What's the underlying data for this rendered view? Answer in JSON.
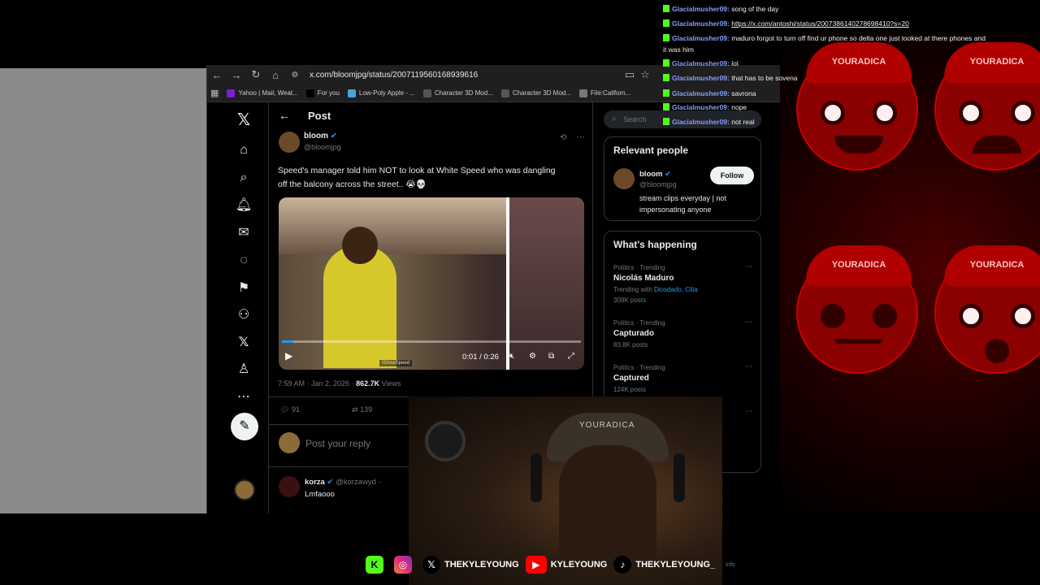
{
  "browser": {
    "url": "x.com/bloomjpg/status/2007119560168939616",
    "bookmarks": [
      {
        "label": "Yahoo | Mail, Weat...",
        "color": "#7b1fd2"
      },
      {
        "label": "For you",
        "color": "#000000"
      },
      {
        "label": "Low-Poly Apple - ...",
        "color": "#4aa3df"
      },
      {
        "label": "Character 3D Mod...",
        "color": "#555555"
      },
      {
        "label": "Character 3D Mod...",
        "color": "#555555"
      },
      {
        "label": "File:Californ...",
        "color": "#777777"
      }
    ]
  },
  "post": {
    "header_title": "Post",
    "author_name": "bloom",
    "author_handle": "@bloomjpg",
    "text_line1": "Speed's manager told him NOT to look at White Speed who was dangling",
    "text_line2": "off the balcony across the street.. 😭💀",
    "video_time": "0:01 / 0:26",
    "video_watermark": "IShowSpeed",
    "timestamp": "7:59 AM · Jan 2, 2026 ·",
    "views_count": "862.7K",
    "views_label": "Views",
    "replies": "91",
    "reposts": "139",
    "reply_placeholder": "Post your reply",
    "reply_author": "korza",
    "reply_handle": "@korzawyd ·",
    "reply_text": "Lmfaooo"
  },
  "sidebar": {
    "search_placeholder": "Search",
    "relevant_title": "Relevant people",
    "relevant_name": "bloom",
    "relevant_handle": "@bloomjpg",
    "follow_label": "Follow",
    "relevant_bio_line1": "stream clips everyday | not",
    "relevant_bio_line2": "impersonating anyone",
    "happening_title": "What's happening",
    "trends": [
      {
        "context": "Politics · Trending",
        "name": "Nicolás Maduro",
        "with_label": "Trending with",
        "with_links": "Diosdado, Cilia",
        "posts": "309K posts"
      },
      {
        "context": "Politics · Trending",
        "name": "Capturado",
        "posts": "83.8K posts"
      },
      {
        "context": "Politics · Trending",
        "name": "Captured",
        "posts": "124K posts"
      }
    ],
    "footer_info": "Info"
  },
  "chat": [
    {
      "user": "Glacialmusher09:",
      "msg": "song of the day"
    },
    {
      "user": "Glacialmusher09:",
      "msg": "https://x.com/antoshi/status/2007386140278698410?s=20"
    },
    {
      "user": "Glacialmusher09:",
      "msg": "maduro forgot to turn off find ur phone so delta one just looked at there phones and"
    },
    {
      "user": "",
      "msg": "it was him"
    },
    {
      "user": "Glacialmusher09:",
      "msg": "lol"
    },
    {
      "user": "Glacialmusher09:",
      "msg": "that has to be sovena"
    },
    {
      "user": "Glacialmusher09:",
      "msg": "savrona"
    },
    {
      "user": "Glacialmusher09:",
      "msg": "nope"
    },
    {
      "user": "Glacialmusher09:",
      "msg": "not real"
    }
  ],
  "emote": {
    "cap_text": "YOURADICA"
  },
  "webcam": {
    "cap_text": "YOURADICA"
  },
  "socials": {
    "x_handle": "THEKYLEYOUNG",
    "youtube_handle": "KYLEYOUNG",
    "tiktok_handle": "THEKYLEYOUNG_"
  },
  "colors": {
    "x_blue": "#1d9bf0",
    "kick_green": "#53fc18",
    "youtube_red": "#ff0000"
  }
}
